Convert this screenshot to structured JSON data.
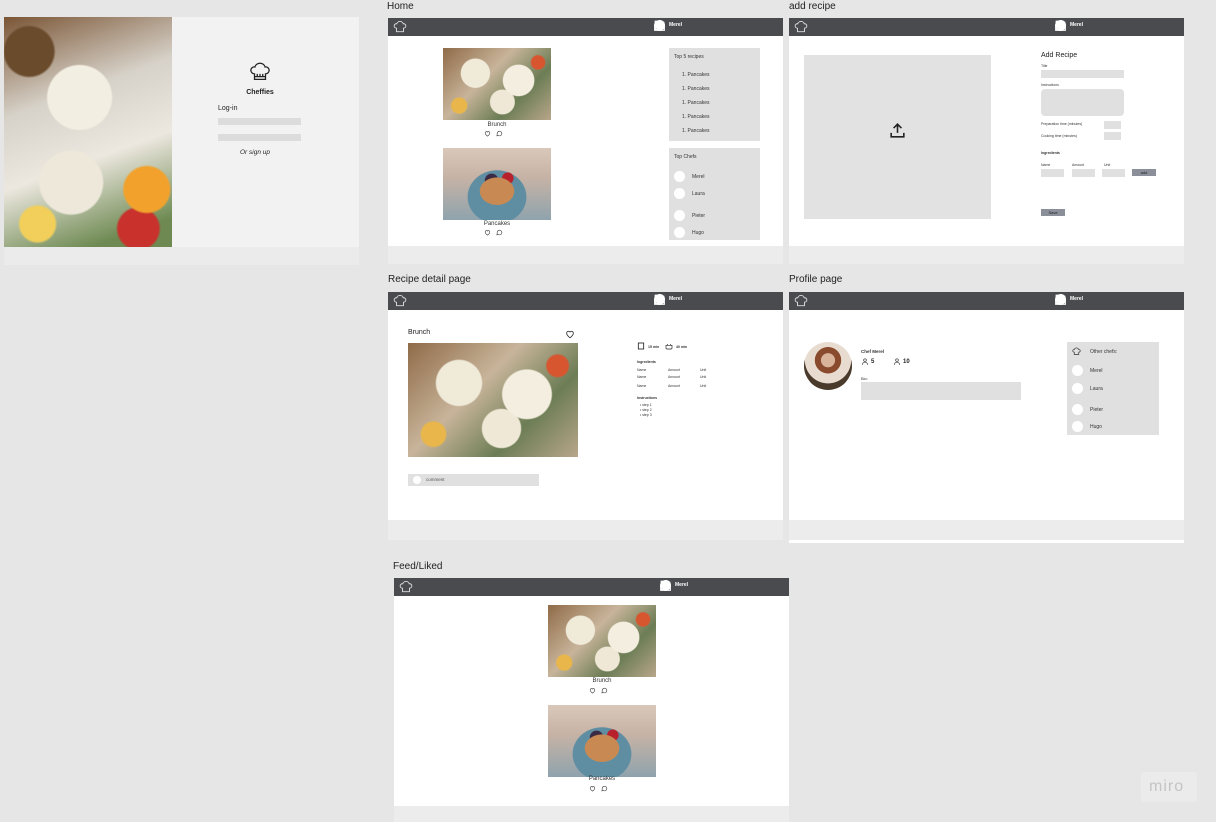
{
  "frames": {
    "home": "Home",
    "add_recipe": "add recipe",
    "recipe_detail": "Recipe detail page",
    "profile": "Profile page",
    "feed": "Feed/Liked"
  },
  "login": {
    "brand": "Cheffies",
    "login_label": "Log-in",
    "signup": "Or sign up"
  },
  "nav": {
    "user": "Merel"
  },
  "home": {
    "top_recipes_title": "Top 5 recipes",
    "top_recipes": [
      "1. Pancakes",
      "1. Pancakes",
      "1. Pancakes",
      "1. Pancakes",
      "1. Pancakes"
    ],
    "top_chefs_title": "Top Chefs",
    "top_chefs": [
      "Merel",
      "Laura",
      "Pieter",
      "Hugo"
    ],
    "cards": [
      "Brunch",
      "Pancakes"
    ]
  },
  "add_recipe": {
    "title": "Add Recipe",
    "field_title": "Title",
    "field_instructions": "Instructions",
    "prep_time": "Preparation time (minutes)",
    "cook_time": "Cooking time (minutes)",
    "ingredients": "Ingredients",
    "col_name": "Name",
    "col_amount": "Amount",
    "col_unit": "Unit",
    "add_button": "add",
    "save_button": "Save"
  },
  "detail": {
    "title": "Brunch",
    "prep": "15 min",
    "cook": "40 min",
    "ingredients_title": "Ingredients",
    "ingredients": [
      {
        "name": "Name",
        "amount": "Amount",
        "unit": "Unit"
      },
      {
        "name": "Name",
        "amount": "Amount",
        "unit": "Unit"
      },
      {
        "name": "Name",
        "amount": "Amount",
        "unit": "Unit"
      }
    ],
    "instructions_title": "Instructions",
    "steps": [
      "step 1",
      "step 2",
      "step 3"
    ],
    "comment_placeholder": "comment"
  },
  "profile": {
    "name": "Chef Merel",
    "followers": "5",
    "following": "10",
    "bio_label": "Bio:",
    "other_chefs": "Other chefs:",
    "chefs": [
      "Merel",
      "Laura",
      "Pieter",
      "Hugo"
    ]
  },
  "feed": {
    "cards": [
      "Brunch",
      "Pancakes"
    ]
  },
  "watermark": "miro"
}
